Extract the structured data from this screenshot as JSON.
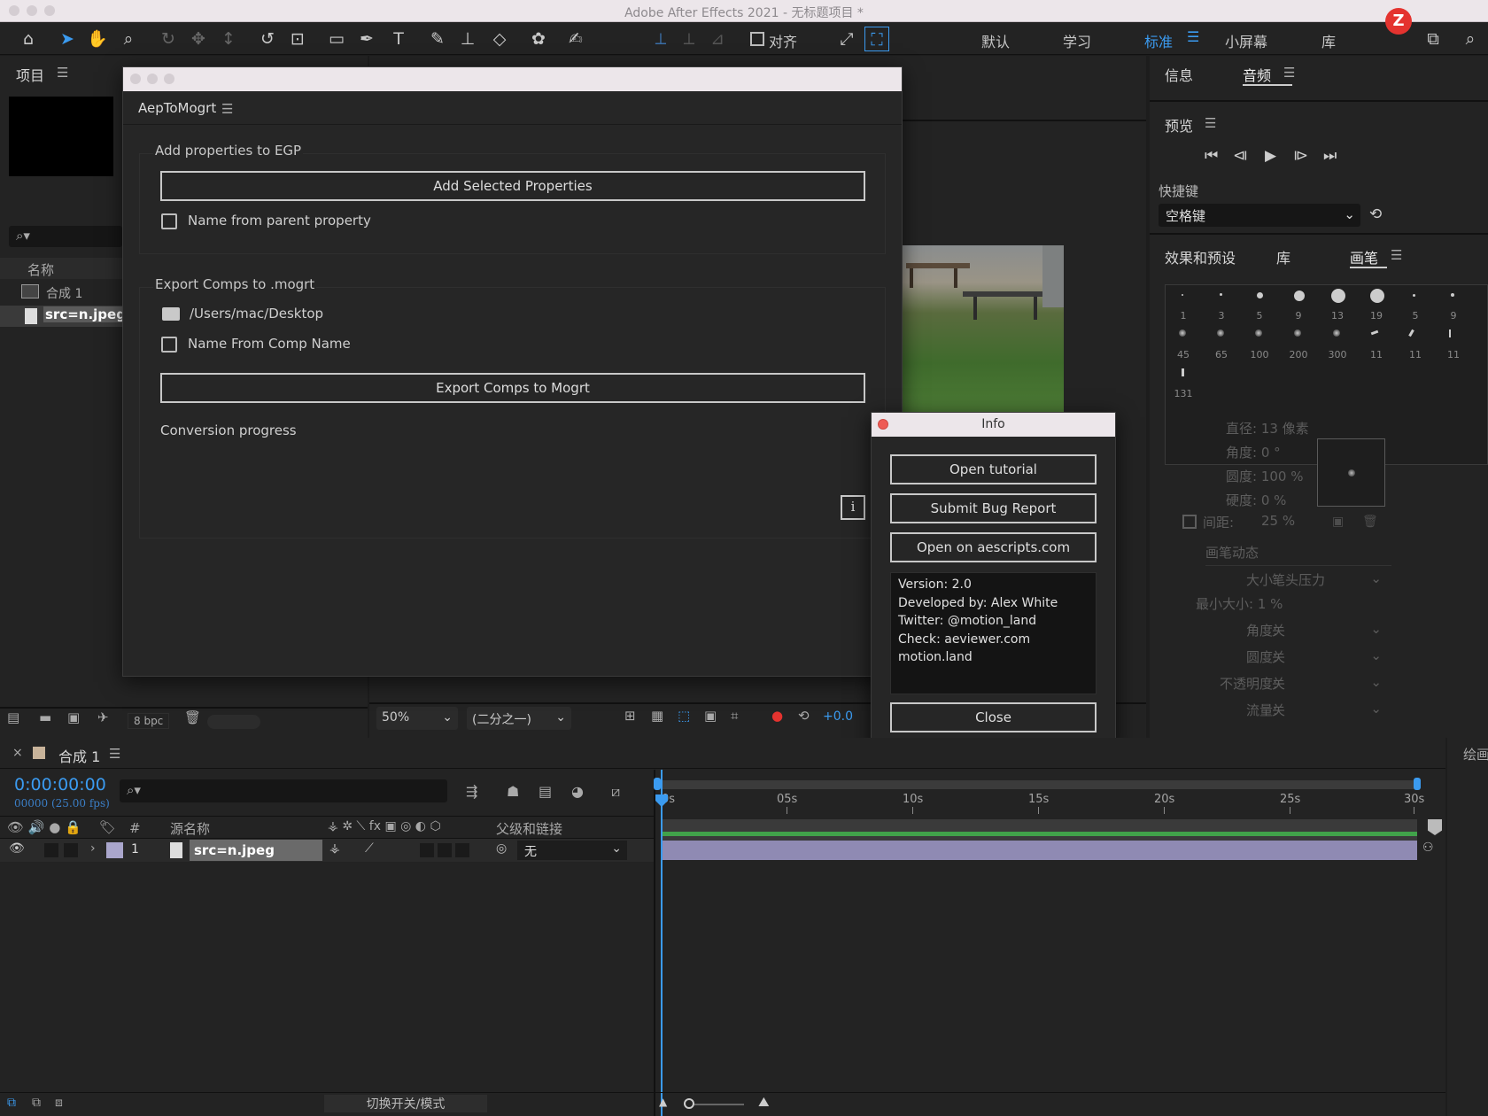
{
  "window": {
    "title": "Adobe After Effects 2021 - 无标题项目 *"
  },
  "workspaces": [
    "默认",
    "学习",
    "标准",
    "小屏幕",
    "库"
  ],
  "workspace_active": "标准",
  "toolbar": {
    "align_label": "对齐"
  },
  "project": {
    "title": "项目",
    "search_placeholder": "",
    "col_name": "名称",
    "items": [
      {
        "name": "合成 1"
      },
      {
        "name": "src=n.jpeg"
      }
    ],
    "bpc": "8 bpc"
  },
  "plugin": {
    "title": "AepToMogrt",
    "group1": "Add properties to EGP",
    "add_selected": "Add Selected Properties",
    "name_from_parent": "Name from parent property",
    "group2": "Export Comps to .mogrt",
    "path": "/Users/mac/Desktop",
    "name_from_comp": "Name From Comp Name",
    "export_btn": "Export Comps to Mogrt",
    "progress_label": "Conversion progress",
    "info_icon": "i"
  },
  "info_dialog": {
    "title": "Info",
    "open_tutorial": "Open tutorial",
    "submit_bug": "Submit Bug Report",
    "open_aescripts": "Open on aescripts.com",
    "details": [
      "Version: 2.0",
      "Developed by: Alex White",
      "Twitter: @motion_land",
      "Check: aeviewer.com",
      "motion.land"
    ],
    "close": "Close"
  },
  "viewer": {
    "zoom": "50%",
    "resolution": "(二分之一)",
    "exposure": "+0.0"
  },
  "right_panels": {
    "info_tab": "信息",
    "audio_tab": "音频",
    "preview_title": "预览",
    "shortcut_label": "快捷键",
    "shortcut_value": "空格键",
    "effects_tab": "效果和预设",
    "library_tab": "库",
    "brush_tab": "画笔",
    "brush_sizes_row1": [
      "1",
      "3",
      "5",
      "9",
      "13",
      "19",
      "5",
      "9"
    ],
    "brush_sizes_row2": [
      "45",
      "65",
      "100",
      "200",
      "300",
      "11",
      "11",
      "11"
    ],
    "brush_sizes_row3": [
      "131"
    ],
    "diameter": "直径: 13 像素",
    "angle": "角度: 0 °",
    "roundness": "圆度: 100 %",
    "hardness": "硬度: 0 %",
    "spacing_label": "间距:",
    "spacing_value": "25 %",
    "dynamics_title": "画笔动态",
    "size_label": "大小:",
    "size_value": "笔头压力",
    "min_size": "最小大小: 1 %",
    "d_angle": "角度:",
    "d_roundness": "圆度:",
    "d_opacity": "不透明度:",
    "d_flow": "流量:",
    "off": "关",
    "paint_tab": "绘画"
  },
  "timeline": {
    "comp_tab": "合成 1",
    "timecode": "0:00:00:00",
    "frames": "00000 (25.00 fps)",
    "hdr_num": "#",
    "hdr_source": "源名称",
    "hdr_parent": "父级和链接",
    "ruler": [
      "0s",
      "05s",
      "10s",
      "15s",
      "20s",
      "25s",
      "30s"
    ],
    "layer": {
      "num": "1",
      "name": "src=n.jpeg",
      "parent": "无"
    },
    "toggle_modes": "切换开关/模式"
  },
  "colors": {
    "accent_blue": "#2d8ceb",
    "timecode_blue": "#3b9bf0",
    "layer_bar": "#8f8ab3",
    "workarea": "#41a24a"
  }
}
